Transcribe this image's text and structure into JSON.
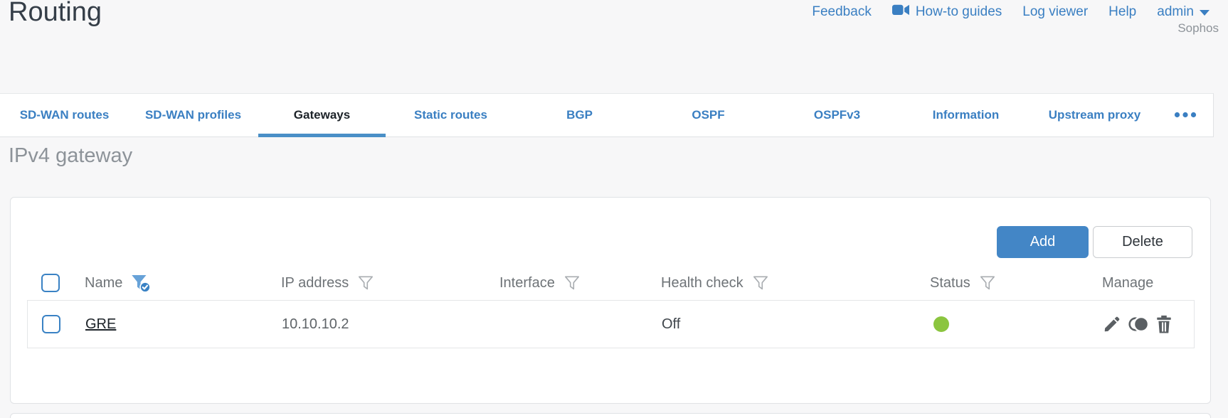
{
  "header": {
    "title": "Routing",
    "nav": {
      "feedback": "Feedback",
      "howto_guides": "How-to guides",
      "log_viewer": "Log viewer",
      "help": "Help",
      "user": "admin",
      "brand": "Sophos"
    }
  },
  "tabs": {
    "items": [
      {
        "label": "SD-WAN routes",
        "active": false
      },
      {
        "label": "SD-WAN profiles",
        "active": false
      },
      {
        "label": "Gateways",
        "active": true
      },
      {
        "label": "Static routes",
        "active": false
      },
      {
        "label": "BGP",
        "active": false
      },
      {
        "label": "OSPF",
        "active": false
      },
      {
        "label": "OSPFv3",
        "active": false
      },
      {
        "label": "Information",
        "active": false
      },
      {
        "label": "Upstream proxy",
        "active": false
      }
    ],
    "more_icon": "ellipsis-icon"
  },
  "section": {
    "heading": "IPv4 gateway"
  },
  "toolbar": {
    "add": "Add",
    "delete": "Delete"
  },
  "table": {
    "columns": {
      "name": {
        "label": "Name",
        "filter": "active-with-check"
      },
      "ip": {
        "label": "IP address",
        "filter": "default"
      },
      "interface": {
        "label": "Interface",
        "filter": "default"
      },
      "health": {
        "label": "Health check",
        "filter": "default"
      },
      "status": {
        "label": "Status",
        "filter": "default"
      },
      "manage": {
        "label": "Manage"
      }
    },
    "rows": [
      {
        "name": "GRE",
        "ip": "10.10.10.2",
        "interface": "",
        "health_check": "Off",
        "status": "green",
        "manage_actions": [
          "edit",
          "clone",
          "delete"
        ]
      }
    ]
  },
  "colors": {
    "accent_blue": "#3A82C4",
    "button_blue": "#4386C6",
    "tab_underline": "#4A8FC7",
    "status_green": "#8BC53F",
    "icon_gray": "#5A5F63"
  }
}
